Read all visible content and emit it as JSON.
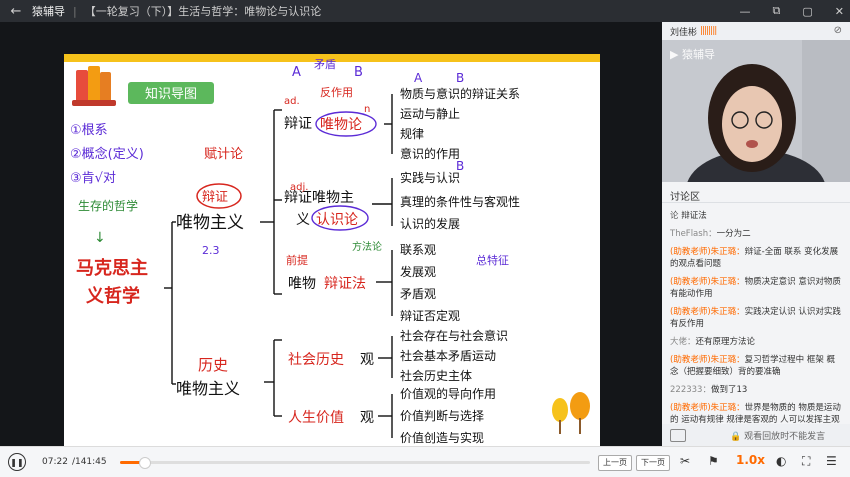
{
  "titlebar": {
    "back": "←",
    "app_name": "猿辅导",
    "separator": "|",
    "course_title": "【一轮复习（下）】生活与哲学：唯物论与认识论",
    "controls": [
      "—",
      "⧉",
      "▢",
      "✕"
    ]
  },
  "slide": {
    "badge": "知识导图",
    "colors": {
      "accent_yellow": "#f6c21b",
      "badge_green": "#5cb85c",
      "red": "#d7261e",
      "purple": "#5b2bd6",
      "green": "#2e8b36"
    },
    "handwritten": {
      "left_list": [
        "①根系",
        "②概念(定义)",
        "③肯√对"
      ],
      "green_note": "生存的哲学",
      "red_note": "赋计论",
      "red_dialectic": "辩证",
      "numbers": "2.3",
      "label_A1": "A",
      "label_B1": "B",
      "arrow_mid": "矛盾",
      "top_mark": "反作用",
      "ad1": "ad.",
      "n1": "n",
      "ad2": "adj.",
      "A2": "A",
      "B2": "B",
      "B3": "B",
      "side_mark": "前提",
      "side_mark2": "方法论",
      "method_note": "总特征"
    },
    "left_heading": [
      "马克思主",
      "义哲学"
    ],
    "center": "唯物主义",
    "sections": {
      "dialectical": {
        "label": "辩证",
        "materialism": "唯物论",
        "items": [
          "物质与意识的辩证关系",
          "运动与静止",
          "规律",
          "意识的作用"
        ],
        "sub2_label_a": "辩证唯物主",
        "sub2_label_b": "义",
        "sub2_highlight": "认识论",
        "sub2_items": [
          "实践与认识",
          "真理的条件性与客观性",
          "认识的发展"
        ],
        "sub3_label": "唯物",
        "sub3_highlight": "辩证法",
        "sub3_items": [
          "联系观",
          "发展观",
          "矛盾观",
          "辩证否定观"
        ]
      },
      "historical": {
        "label_top": "历史",
        "label_bottom": "唯物主义",
        "social": "社会历史",
        "social_suffix": "观",
        "social_items": [
          "社会存在与社会意识",
          "社会基本矛盾运动",
          "社会历史主体"
        ],
        "life": "人生价值",
        "life_suffix": "观",
        "life_items": [
          "价值观的导向作用",
          "价值判断与选择",
          "价值创造与实现"
        ]
      }
    }
  },
  "teacher": {
    "name": "刘佳彬",
    "signal": "||||||||",
    "watermark": "▶ 猿辅导"
  },
  "discussion": {
    "title": "讨论区",
    "messages": [
      {
        "user": "论",
        "text": "辩证法",
        "type": "plain"
      },
      {
        "user": "TheFlash：",
        "text": "一分为二",
        "type": "plain"
      },
      {
        "user": "(助教老师)朱正璐：",
        "text": "辩证-全面 联系 变化发展的观点看问题",
        "type": "ta"
      },
      {
        "user": "(助教老师)朱正璐：",
        "text": "物质决定意识 意识对物质有能动作用",
        "type": "ta"
      },
      {
        "user": "(助教老师)朱正璐：",
        "text": "实践决定认识 认识对实践有反作用",
        "type": "ta"
      },
      {
        "user": "大佬：",
        "text": "还有原理方法论",
        "type": "plain"
      },
      {
        "user": "(助教老师)朱正璐：",
        "text": "复习哲学过程中 框架 概念（把握要细致）背的要准确",
        "type": "ta"
      },
      {
        "user": "222333：",
        "text": "做到了13",
        "type": "plain"
      },
      {
        "user": "(助教老师)朱正璐：",
        "text": "世界是物质的 物质是运动的 运动有规律 规律是客观的 人可以发挥主观能动性",
        "type": "ta"
      }
    ],
    "footer": "🔒 观看回放时不能发言"
  },
  "player": {
    "current_time": "07:22",
    "total_time": "/141:45",
    "progress_fraction": 0.052,
    "prev_label": "上一页",
    "next_label": "下一页",
    "speed": "1.0x",
    "icons": [
      "play-icon",
      "scissors-icon",
      "flag-icon",
      "volume-icon",
      "fullscreen-icon",
      "menu-icon"
    ]
  }
}
